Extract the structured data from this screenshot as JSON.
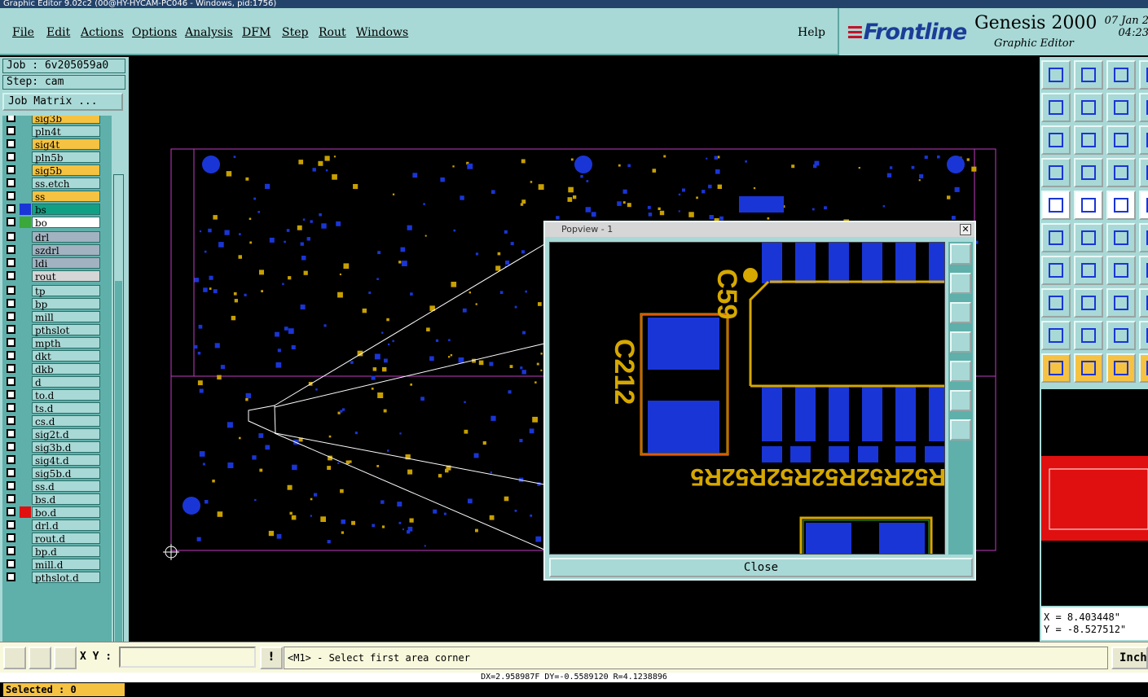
{
  "window": {
    "title": "Graphic Editor 9.02c2 (00@HY-HYCAM-PC046 - Windows, pid:1756)"
  },
  "menu": {
    "file": "File",
    "edit": "Edit",
    "actions": "Actions",
    "options": "Options",
    "analysis": "Analysis",
    "dfm": "DFM",
    "step": "Step",
    "rout": "Rout",
    "windows": "Windows",
    "help": "Help"
  },
  "brand": {
    "logo": "Frontline",
    "product": "Genesis 2000",
    "subtitle": "Graphic Editor",
    "date": "07 Jan 2",
    "time": "04:23"
  },
  "job": {
    "job_label": "Job : 6v205059a0",
    "step_label": "Step: cam",
    "job_matrix_button": "Job Matrix ..."
  },
  "layers": [
    {
      "name": "sig3b",
      "color": "#f5c242"
    },
    {
      "name": "pln4t",
      "color": "#a8d9d6"
    },
    {
      "name": "sig4t",
      "color": "#f5c242"
    },
    {
      "name": "pln5b",
      "color": "#a8d9d6"
    },
    {
      "name": "sig5b",
      "color": "#f5c242"
    },
    {
      "name": "ss.etch",
      "color": "#a8d9d6"
    },
    {
      "name": "ss",
      "color": "#f5c242"
    },
    {
      "name": "bs",
      "color": "#12a085",
      "swatch": "#1a35d6"
    },
    {
      "name": "bo",
      "color": "#ffffff",
      "swatch": "#3aa83a"
    },
    {
      "name": "drl",
      "color": "#a2b2c0"
    },
    {
      "name": "szdrl",
      "color": "#a2b2c0"
    },
    {
      "name": "ldi",
      "color": "#a2b2c0"
    },
    {
      "name": "rout",
      "color": "#d6d6d6"
    },
    {
      "name": "tp",
      "color": "#a8d9d6"
    },
    {
      "name": "bp",
      "color": "#a8d9d6"
    },
    {
      "name": "mill",
      "color": "#a8d9d6"
    },
    {
      "name": "pthslot",
      "color": "#a8d9d6"
    },
    {
      "name": "mpth",
      "color": "#a8d9d6"
    },
    {
      "name": "dkt",
      "color": "#a8d9d6"
    },
    {
      "name": "dkb",
      "color": "#a8d9d6"
    },
    {
      "name": "d",
      "color": "#a8d9d6"
    },
    {
      "name": "to.d",
      "color": "#a8d9d6"
    },
    {
      "name": "ts.d",
      "color": "#a8d9d6"
    },
    {
      "name": "cs.d",
      "color": "#a8d9d6"
    },
    {
      "name": "sig2t.d",
      "color": "#a8d9d6"
    },
    {
      "name": "sig3b.d",
      "color": "#a8d9d6"
    },
    {
      "name": "sig4t.d",
      "color": "#a8d9d6"
    },
    {
      "name": "sig5b.d",
      "color": "#a8d9d6"
    },
    {
      "name": "ss.d",
      "color": "#a8d9d6"
    },
    {
      "name": "bs.d",
      "color": "#a8d9d6"
    },
    {
      "name": "bo.d",
      "color": "#a8d9d6",
      "swatch": "#e01010"
    },
    {
      "name": "drl.d",
      "color": "#a8d9d6"
    },
    {
      "name": "rout.d",
      "color": "#a8d9d6"
    },
    {
      "name": "bp.d",
      "color": "#a8d9d6"
    },
    {
      "name": "mill.d",
      "color": "#a8d9d6"
    },
    {
      "name": "pthslot.d",
      "color": "#a8d9d6"
    }
  ],
  "selected": "Selected : 0",
  "popup": {
    "title": "Popview - 1",
    "close_label": "Close",
    "silk_c59": "C59",
    "silk_c212": "C212",
    "silk_text": "R52R52R52R52R52R5"
  },
  "coords": {
    "x": "X =  8.403448\"",
    "y": "Y = -8.527512\""
  },
  "status": {
    "xy_label": "X Y :",
    "xy_value": "",
    "message": "<M1> - Select first area corner",
    "units": "Inch",
    "info_button": "!"
  },
  "bottom": {
    "text": "DX=2.958987F DY=-0.5589120 R=4.1238896"
  }
}
